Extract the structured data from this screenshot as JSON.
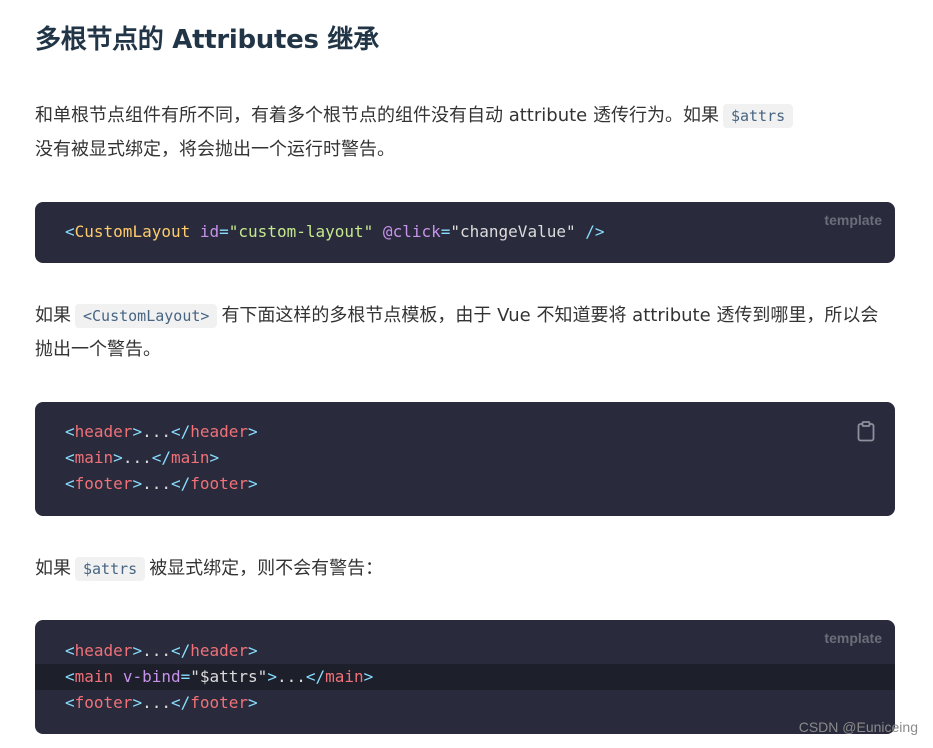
{
  "heading": "多根节点的 Attributes 继承",
  "para1": {
    "text_a": "和单根节点组件有所不同，有着多个根节点的组件没有自动 attribute 透传行为。如果",
    "code": "$attrs",
    "text_b": "没有被显式绑定，将会抛出一个运行时警告。"
  },
  "code1": {
    "lang": "template",
    "line": {
      "open": "<",
      "component": "CustomLayout",
      "attr1": "id",
      "eq1": "=",
      "val1": "\"custom-layout\"",
      "at": "@",
      "attr2": "click",
      "eq2": "=",
      "val2": "\"changeValue\"",
      "close": " />"
    }
  },
  "para2": {
    "text_a": "如果",
    "code": "<CustomLayout>",
    "text_b": "有下面这样的多根节点模板，由于 Vue 不知道要将 attribute 透传到哪里，所以会抛出一个警告。"
  },
  "code2": {
    "copy_icon": "clipboard-icon",
    "lines": [
      {
        "lt": "<",
        "tag": "header",
        "gt": ">",
        "dots": "...",
        "lt2": "</",
        "tag2": "header",
        "gt2": ">"
      },
      {
        "lt": "<",
        "tag": "main",
        "gt": ">",
        "dots": "...",
        "lt2": "</",
        "tag2": "main",
        "gt2": ">"
      },
      {
        "lt": "<",
        "tag": "footer",
        "gt": ">",
        "dots": "...",
        "lt2": "</",
        "tag2": "footer",
        "gt2": ">"
      }
    ]
  },
  "para3": {
    "text_a": "如果",
    "code": "$attrs",
    "text_b": "被显式绑定，则不会有警告："
  },
  "code3": {
    "lang": "template",
    "line1": {
      "lt": "<",
      "tag": "header",
      "gt": ">",
      "dots": "...",
      "lt2": "</",
      "tag2": "header",
      "gt2": ">"
    },
    "line2": {
      "lt": "<",
      "tag": "main",
      "attr": "v-bind",
      "eq": "=",
      "val": "\"$attrs\"",
      "gt": ">",
      "dots": "...",
      "lt2": "</",
      "tag2": "main",
      "gt2": ">"
    },
    "line3": {
      "lt": "<",
      "tag": "footer",
      "gt": ">",
      "dots": "...",
      "lt2": "</",
      "tag2": "footer",
      "gt2": ">"
    }
  },
  "watermark": "CSDN @Euniceing"
}
